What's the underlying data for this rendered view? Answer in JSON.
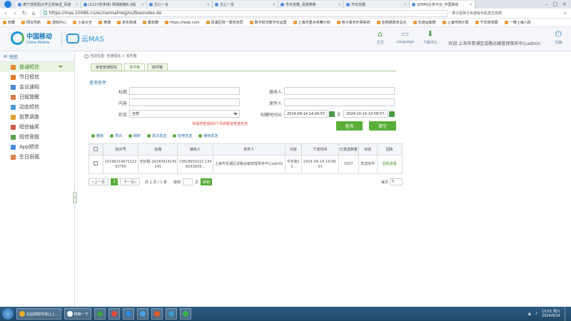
{
  "browser": {
    "tabs": [
      {
        "title": "离宁选校团大学主校休选_百度"
      },
      {
        "title": "(1217封未读) 网易邮箱6.0版"
      },
      {
        "title": "文心一言"
      },
      {
        "title": "文心一言"
      },
      {
        "title": "市长信箱_百度搜索"
      },
      {
        "title": "市长信箱"
      },
      {
        "title": "云MAS业务平台_中国移动"
      }
    ],
    "url": "https://mas.10086.cn/ec/normalmsg/outboxindex.do",
    "news_ticker": "男子因孩子玩游戏手机发生自燃",
    "bookmarks": [
      "收藏",
      "网址导航",
      "游戏中心",
      "小说大全",
      "微博",
      "京东商城",
      "聚划算",
      "https://iwds.com",
      "青浦区统一政务协同",
      "数字经济数字化运营",
      "上海市重点考察计划",
      "电子政务外网系统",
      "全网通政务总台",
      "交通运输部",
      "上海市统计局",
      "千年岸发展",
      "一带上海人民"
    ]
  },
  "header": {
    "logo_cn": "中国移动",
    "logo_en": "China Mobile",
    "product": "云MAS",
    "nav": [
      {
        "label": "主页",
        "icon": "home-icon"
      },
      {
        "label": "Language",
        "icon": "language-icon"
      },
      {
        "label": "下载中心",
        "icon": "download-icon"
      }
    ],
    "welcome": "欢迎 上海市青浦区道路运输管理事务中心admin",
    "logout": "注销"
  },
  "sidebar": {
    "title": "短信",
    "items": [
      {
        "label": "普通短信",
        "color": "#e8892f"
      },
      {
        "label": "节日短信",
        "color": "#e07a2a"
      },
      {
        "label": "会议通知",
        "color": "#4a8ad0"
      },
      {
        "label": "日程提醒",
        "color": "#d07a4a"
      },
      {
        "label": "动态短信",
        "color": "#4a9ae0"
      },
      {
        "label": "投票调查",
        "color": "#e0a030"
      },
      {
        "label": "短信抽奖",
        "color": "#d05a4a"
      },
      {
        "label": "短信答题",
        "color": "#5aa04a"
      },
      {
        "label": "App短信",
        "color": "#4a8ae0"
      },
      {
        "label": "生日祝福",
        "color": "#e0804a"
      }
    ]
  },
  "main": {
    "breadcrumb": "当前位置: 普通短信 > 发件箱",
    "tabs": [
      "审查普通短信",
      "发件箱",
      "收件箱"
    ],
    "query_title": "查询条件",
    "form": {
      "title_label": "标题",
      "content_label": "内容",
      "status_label": "状态",
      "status_value": "全部",
      "receiver_label": "接收人",
      "sender_label": "发件人",
      "time_label": "创建时间从",
      "time_from": "2024-09-14 14:00:57",
      "time_sep": "至",
      "time_to": "2024-10-14 14:58:57"
    },
    "note": "仅提供查询近6个月的短信发送任务",
    "query_btn": "查询",
    "reset_btn": "清空",
    "toolbar": [
      {
        "label": "删除",
        "color": "#58ae37"
      },
      {
        "label": "导出",
        "color": "#58ae37"
      },
      {
        "label": "刷新",
        "color": "#58ae37"
      },
      {
        "label": "再次发送",
        "color": "#58ae37"
      },
      {
        "label": "暂停发送",
        "color": "#58ae37"
      },
      {
        "label": "继续发送",
        "color": "#58ae37"
      }
    ],
    "table": {
      "headers": [
        "批次号",
        "标题",
        "接收人",
        "发件人",
        "内容",
        "下发时间",
        "已发送数量",
        "状态",
        "回执"
      ],
      "rows": [
        {
          "batch": "1019621467522293760",
          "title": "无标题-20240914145141",
          "receiver": "13818950221,1348243839...",
          "sender": "上海市青浦区道路运输管理事务中心admin",
          "content": "今年第13...",
          "time": "2024-09-14 14:58:53",
          "count": "1057",
          "status": "发送完毕",
          "receipt": "回执查看"
        }
      ]
    },
    "pager": {
      "prev": "«上一页",
      "current": "1",
      "next": "下一页»",
      "info": "共 1 页 / 1 条",
      "jump": "跳转",
      "page_suffix": "页",
      "go": "转到",
      "per_page": "每页",
      "page_size": "5"
    }
  },
  "taskbar": {
    "items": [
      {
        "label": "在此抓取市场让上...",
        "color": "#e8b030"
      },
      {
        "label": "搜索一下",
        "color": "#ffffff"
      },
      {
        "label": "",
        "color": "#3aa04a"
      },
      {
        "label": "",
        "color": "#e04a3a"
      },
      {
        "label": "",
        "color": "#2a8ae0"
      },
      {
        "label": "",
        "color": "#4aa0e0"
      },
      {
        "label": "",
        "color": "#e05a2a"
      },
      {
        "label": "",
        "color": "#3a9ad0"
      },
      {
        "label": "",
        "color": "#3ab04a"
      }
    ],
    "time": "15:01 周六",
    "date": "2024/9/14"
  }
}
